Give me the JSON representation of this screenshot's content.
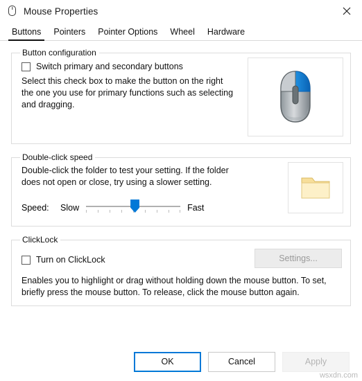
{
  "window": {
    "title": "Mouse Properties",
    "icon": "mouse-icon",
    "close_label": "✕"
  },
  "tabs": [
    {
      "label": "Buttons",
      "active": true
    },
    {
      "label": "Pointers",
      "active": false
    },
    {
      "label": "Pointer Options",
      "active": false
    },
    {
      "label": "Wheel",
      "active": false
    },
    {
      "label": "Hardware",
      "active": false
    }
  ],
  "button_configuration": {
    "legend": "Button configuration",
    "checkbox_label": "Switch primary and secondary buttons",
    "checked": false,
    "description": "Select this check box to make the button on the right the one you use for primary functions such as selecting and dragging.",
    "preview_icon": "mouse-preview-image"
  },
  "double_click_speed": {
    "legend": "Double-click speed",
    "description": "Double-click the folder to test your setting. If the folder does not open or close, try using a slower setting.",
    "speed_label": "Speed:",
    "slow_label": "Slow",
    "fast_label": "Fast",
    "slider_value": 50,
    "folder_icon": "folder-image"
  },
  "clicklock": {
    "legend": "ClickLock",
    "checkbox_label": "Turn on ClickLock",
    "checked": false,
    "settings_label": "Settings...",
    "settings_enabled": false,
    "description": "Enables you to highlight or drag without holding down the mouse button. To set, briefly press the mouse button. To release, click the mouse button again."
  },
  "footer": {
    "ok_label": "OK",
    "cancel_label": "Cancel",
    "apply_label": "Apply"
  },
  "watermark": "wsxdn.com",
  "colors": {
    "accent": "#0078d7",
    "border": "#dcdcdc",
    "text": "#111111"
  }
}
